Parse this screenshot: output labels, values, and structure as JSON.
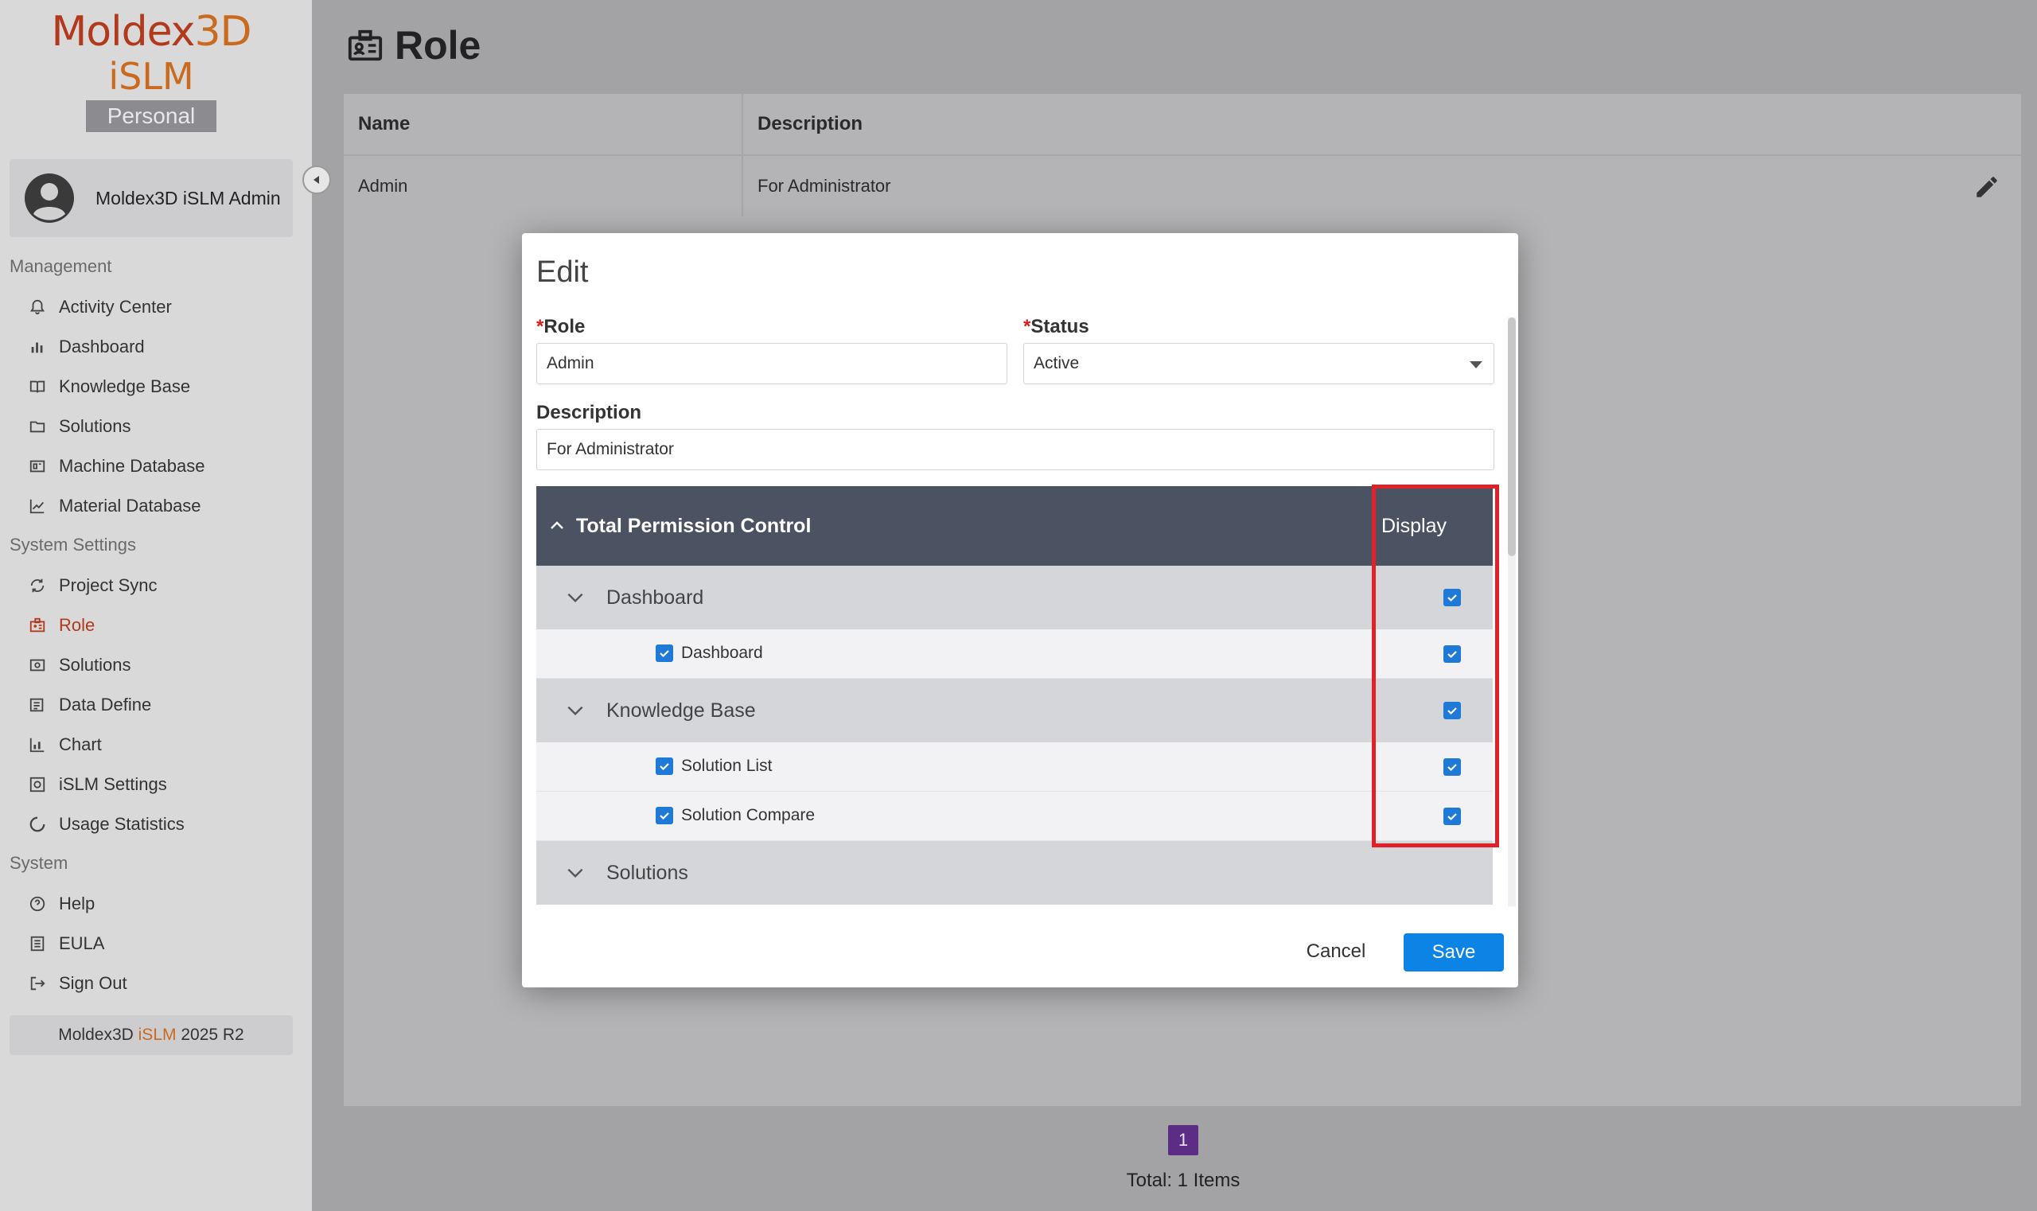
{
  "app": {
    "logo_line1_a": "Moldex",
    "logo_line1_b": "3D",
    "logo_line2": "iSLM",
    "logo_badge": "Personal",
    "user_name": "Moldex3D iSLM Admin",
    "version_prefix": "Moldex3D ",
    "version_accent": "iSLM",
    "version_suffix": " 2025 R2"
  },
  "sidebar": {
    "sections": [
      {
        "title": "Management",
        "items": [
          {
            "label": "Activity Center",
            "icon": "bell-icon"
          },
          {
            "label": "Dashboard",
            "icon": "bar-chart-icon"
          },
          {
            "label": "Knowledge Base",
            "icon": "book-icon"
          },
          {
            "label": "Solutions",
            "icon": "folder-icon"
          },
          {
            "label": "Machine Database",
            "icon": "machine-icon"
          },
          {
            "label": "Material Database",
            "icon": "line-chart-icon"
          }
        ]
      },
      {
        "title": "System Settings",
        "items": [
          {
            "label": "Project Sync",
            "icon": "sync-icon"
          },
          {
            "label": "Role",
            "icon": "role-icon",
            "active": true
          },
          {
            "label": "Solutions",
            "icon": "solutions-icon"
          },
          {
            "label": "Data Define",
            "icon": "data-define-icon"
          },
          {
            "label": "Chart",
            "icon": "chart-icon"
          },
          {
            "label": "iSLM Settings",
            "icon": "settings-icon"
          },
          {
            "label": "Usage Statistics",
            "icon": "statistics-icon"
          }
        ]
      },
      {
        "title": "System",
        "items": [
          {
            "label": "Help",
            "icon": "help-icon"
          },
          {
            "label": "EULA",
            "icon": "document-icon"
          },
          {
            "label": "Sign Out",
            "icon": "sign-out-icon"
          }
        ]
      }
    ]
  },
  "page": {
    "title": "Role",
    "table": {
      "headers": [
        "Name",
        "Description"
      ],
      "rows": [
        [
          "Admin",
          "For Administrator"
        ]
      ]
    },
    "pagination": {
      "current": "1"
    },
    "total": "Total: 1 Items"
  },
  "modal": {
    "title": "Edit",
    "role_label": "Role",
    "role_value": "Admin",
    "status_label": "Status",
    "status_value": "Active",
    "description_label": "Description",
    "description_value": "For Administrator",
    "required_mark": "*",
    "permission": {
      "header": "Total Permission Control",
      "display_header": "Display",
      "groups": [
        {
          "label": "Dashboard",
          "checked": true,
          "items": [
            {
              "label": "Dashboard",
              "checked": true
            }
          ]
        },
        {
          "label": "Knowledge Base",
          "checked": true,
          "items": [
            {
              "label": "Solution List",
              "checked": true
            },
            {
              "label": "Solution Compare",
              "checked": true
            }
          ]
        },
        {
          "label": "Solutions",
          "items": []
        }
      ]
    },
    "cancel_label": "Cancel",
    "save_label": "Save"
  },
  "colors": {
    "accent_red": "#b2391b",
    "accent_orange": "#c96a1f",
    "primary_blue": "#0b84e6",
    "highlight_red": "#e0212a",
    "header_dark": "#4b5261"
  }
}
